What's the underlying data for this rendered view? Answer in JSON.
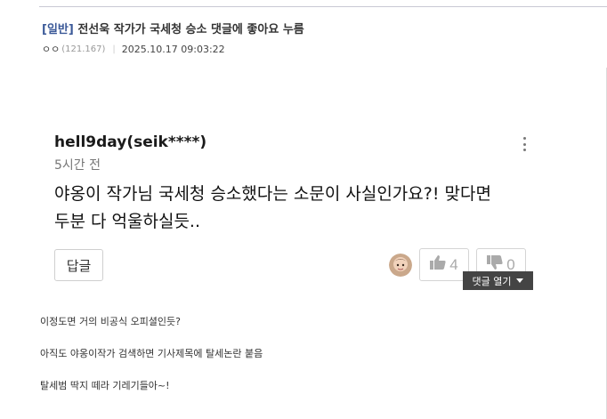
{
  "post": {
    "category": "[일반]",
    "title": "전선욱 작가가 국세청 승소 댓글에 좋아요 누름",
    "author_nick": "ㅇㅇ",
    "author_ip": "(121.167)",
    "date": "2025.10.17 09:03:22"
  },
  "comment": {
    "author": "hell9day(seik****)",
    "time": "5시간 전",
    "text_line1": "야옹이 작가님 국세청 승소했다는 소문이 사실인가요?! 맞다면",
    "text_line2": "두분 다 억울하실듯..",
    "reply_label": "답글",
    "like_count": "4",
    "dislike_count": "0",
    "reply_toggle_label": "댓글 열기"
  },
  "body_lines": [
    "이정도면 거의 비공식 오피셜인듯?",
    "아직도 야옹이작가 검색하면 기사제목에 탈세논란 붙음",
    "탈세범 딱지 떼라 기레기들아~!"
  ],
  "icons": {
    "more": "kebab-menu-icon",
    "like": "thumbs-up-icon",
    "dislike": "thumbs-down-icon",
    "toggle": "caret-down-icon"
  },
  "colors": {
    "category": "#3b5998",
    "toggle_bg": "#444444"
  }
}
